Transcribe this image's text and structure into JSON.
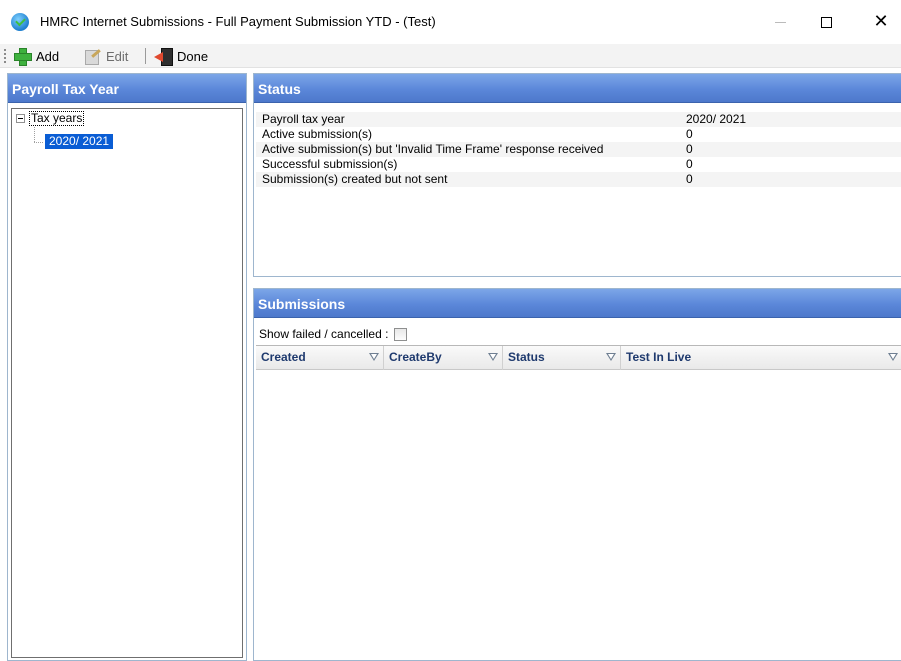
{
  "window": {
    "title": "HMRC Internet Submissions - Full Payment Submission YTD - (Test)",
    "minimize_glyph": "—",
    "maximize_glyph": "☐",
    "close_glyph": "✕"
  },
  "toolbar": {
    "add_label": "Add",
    "edit_label": "Edit",
    "done_label": "Done"
  },
  "left_panel": {
    "title": "Payroll Tax Year",
    "tree": {
      "root": "Tax years",
      "children": [
        "2020/ 2021"
      ]
    }
  },
  "status": {
    "title": "Status",
    "rows": [
      {
        "label": "Payroll tax year",
        "value": "2020/ 2021"
      },
      {
        "label": "Active submission(s)",
        "value": "0"
      },
      {
        "label": "Active submission(s) but 'Invalid Time Frame' response received",
        "value": "0"
      },
      {
        "label": "Successful submission(s)",
        "value": "0"
      },
      {
        "label": "Submission(s) created but not sent",
        "value": "0"
      }
    ]
  },
  "submissions": {
    "title": "Submissions",
    "show_failed_label": "Show failed / cancelled :",
    "show_failed_checked": false,
    "columns": [
      "Created",
      "CreateBy",
      "Status",
      "Test In Live"
    ],
    "rows": []
  },
  "colors": {
    "panel_header": "#5b87d9",
    "selection": "#0a5dd4",
    "column_header_text": "#1f3a6e"
  }
}
